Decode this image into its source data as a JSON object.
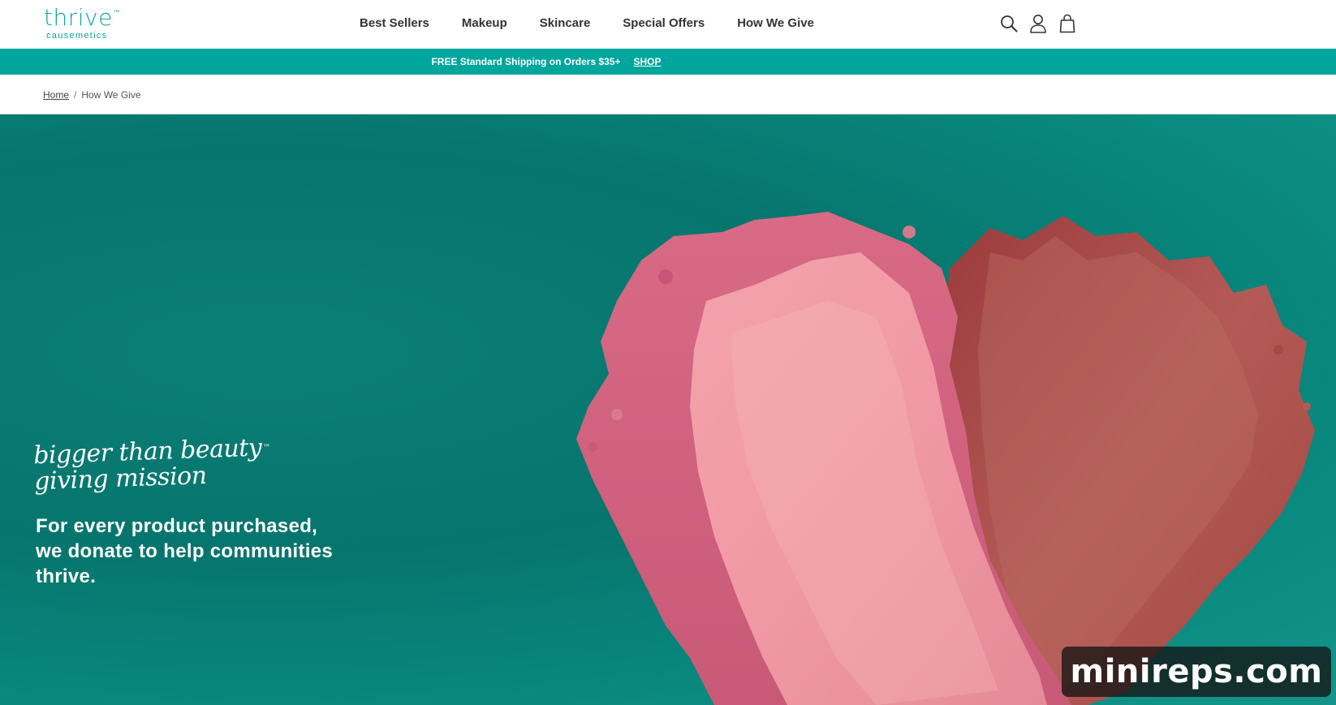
{
  "brand": {
    "logo_main": "thrive",
    "logo_tm": "™",
    "logo_sub": "causemetics",
    "accent_color": "#00a69c"
  },
  "nav": {
    "items": [
      {
        "label": "Best Sellers"
      },
      {
        "label": "Makeup"
      },
      {
        "label": "Skincare"
      },
      {
        "label": "Special Offers"
      },
      {
        "label": "How We Give"
      }
    ]
  },
  "header_icons": [
    "search-icon",
    "account-icon",
    "shopping-bag-icon"
  ],
  "promo": {
    "text": "FREE Standard Shipping on Orders $35+",
    "link": "SHOP"
  },
  "breadcrumb": {
    "home": "Home",
    "separator": "/",
    "current": "How We Give"
  },
  "hero": {
    "tagline_line1": "bigger than beauty",
    "tagline_tm": "™",
    "tagline_line2": "giving mission",
    "copy": "For every product purchased, we donate to help communities thrive."
  },
  "watermark": {
    "text": "minireps.com"
  }
}
